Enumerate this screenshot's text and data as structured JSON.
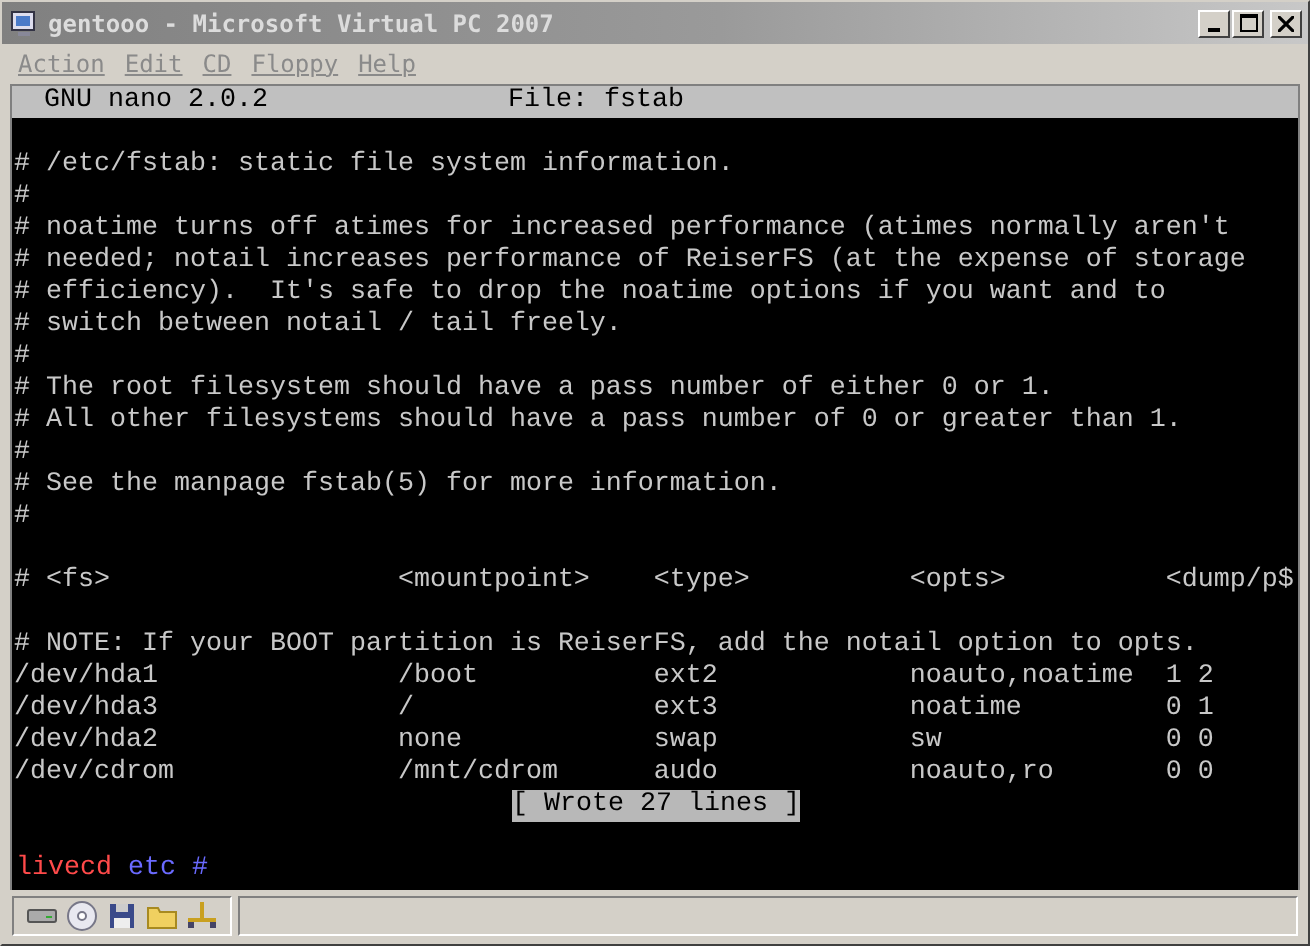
{
  "window": {
    "title": "gentooo - Microsoft Virtual PC 2007"
  },
  "menu": [
    {
      "label": "Action"
    },
    {
      "label": "Edit"
    },
    {
      "label": "CD"
    },
    {
      "label": "Floppy"
    },
    {
      "label": "Help"
    }
  ],
  "terminal": {
    "header": {
      "app": "GNU nano 2.0.2",
      "file": "File: fstab"
    },
    "lines": [
      {
        "kind": "blank"
      },
      {
        "kind": "text",
        "text": "# /etc/fstab: static file system information."
      },
      {
        "kind": "text",
        "text": "#"
      },
      {
        "kind": "text",
        "text": "# noatime turns off atimes for increased performance (atimes normally aren't"
      },
      {
        "kind": "text",
        "text": "# needed; notail increases performance of ReiserFS (at the expense of storage"
      },
      {
        "kind": "text",
        "text": "# efficiency).  It's safe to drop the noatime options if you want and to"
      },
      {
        "kind": "text",
        "text": "# switch between notail / tail freely."
      },
      {
        "kind": "text",
        "text": "#"
      },
      {
        "kind": "text",
        "text": "# The root filesystem should have a pass number of either 0 or 1."
      },
      {
        "kind": "text",
        "text": "# All other filesystems should have a pass number of 0 or greater than 1."
      },
      {
        "kind": "text",
        "text": "#"
      },
      {
        "kind": "text",
        "text": "# See the manpage fstab(5) for more information."
      },
      {
        "kind": "text",
        "text": "#"
      },
      {
        "kind": "blank"
      },
      {
        "kind": "text",
        "text": "# <fs>                  <mountpoint>    <type>          <opts>          <dump/p$"
      },
      {
        "kind": "blank"
      },
      {
        "kind": "text",
        "text": "# NOTE: If your BOOT partition is ReiserFS, add the notail option to opts."
      },
      {
        "kind": "text",
        "text": "/dev/hda1               /boot           ext2            noauto,noatime  1 2"
      },
      {
        "kind": "text",
        "text": "/dev/hda3               /               ext3            noatime         0 1"
      },
      {
        "kind": "text",
        "text": "/dev/hda2               none            swap            sw              0 0"
      },
      {
        "kind": "text",
        "text": "/dev/cdrom              /mnt/cdrom      audo            noauto,ro       0 0"
      }
    ],
    "status_message": "[ Wrote 27 lines ]",
    "prompt": {
      "host": "livecd",
      "dir": "etc",
      "symbol": "#"
    }
  }
}
